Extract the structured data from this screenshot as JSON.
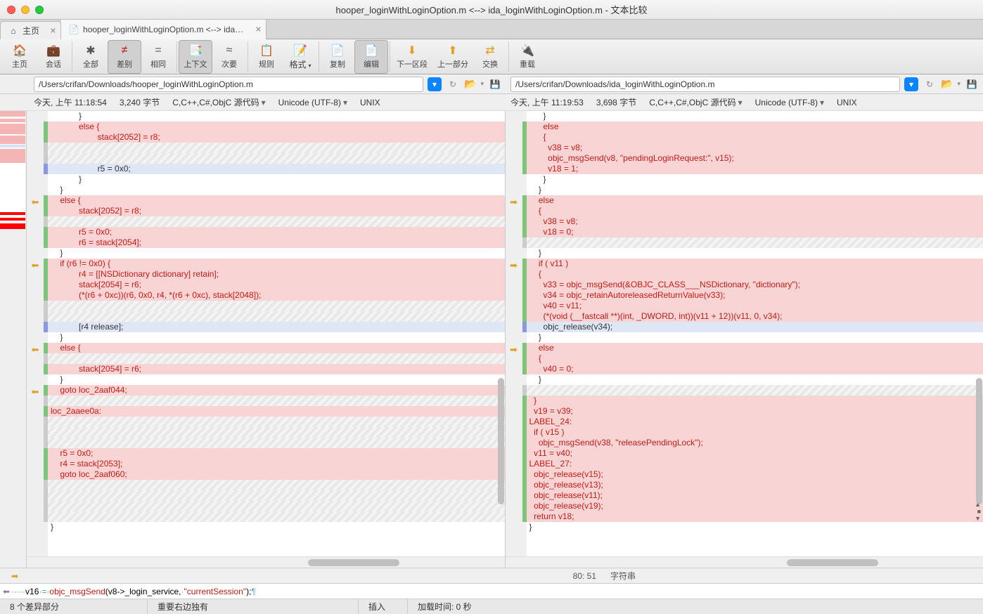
{
  "window": {
    "title": "hooper_loginWithLoginOption.m <--> ida_loginWithLoginOption.m - 文本比较"
  },
  "tabs": {
    "home": "主页",
    "compare": "hooper_loginWithLoginOption.m <--> ida_login..."
  },
  "toolbar": {
    "home": "主页",
    "session": "会话",
    "all": "全部",
    "diff": "差别",
    "same": "相同",
    "context": "上下文",
    "secondary": "次要",
    "rules": "规则",
    "format": "格式",
    "copy": "复制",
    "edit": "编辑",
    "nextsec": "下一区段",
    "prevsec": "上一部分",
    "swap": "交换",
    "reload": "重载"
  },
  "paths": {
    "left": "/Users/crifan/Downloads/hooper_loginWithLoginOption.m",
    "right": "/Users/crifan/Downloads/ida_loginWithLoginOption.m"
  },
  "meta": {
    "left": {
      "time": "今天, 上午 11:18:54",
      "size": "3,240 字节",
      "lang": "C,C++,C#,ObjC 源代码",
      "enc": "Unicode (UTF-8)",
      "eol": "UNIX"
    },
    "right": {
      "time": "今天, 上午 11:19:53",
      "size": "3,698 字节",
      "lang": "C,C++,C#,ObjC 源代码",
      "enc": "Unicode (UTF-8)",
      "eol": "UNIX"
    }
  },
  "lcode": [
    {
      "c": "",
      "t": "            }"
    },
    {
      "c": "d",
      "t": "            else {"
    },
    {
      "c": "d",
      "t": "                    stack[2052] = r8;"
    },
    {
      "c": "h",
      "t": ""
    },
    {
      "c": "h",
      "t": ""
    },
    {
      "c": "s",
      "t": "                    r5 = 0x0;"
    },
    {
      "c": "",
      "t": "            }"
    },
    {
      "c": "",
      "t": "    }"
    },
    {
      "c": "d",
      "t": "    else {"
    },
    {
      "c": "d",
      "t": "            stack[2052] = r8;"
    },
    {
      "c": "h",
      "t": ""
    },
    {
      "c": "d",
      "t": "            r5 = 0x0;"
    },
    {
      "c": "d",
      "t": "            r6 = stack[2054];"
    },
    {
      "c": "",
      "t": "    }"
    },
    {
      "c": "d",
      "t": "    if (r6 != 0x0) {"
    },
    {
      "c": "d",
      "t": "            r4 = [[NSDictionary dictionary] retain];"
    },
    {
      "c": "d",
      "t": "            stack[2054] = r6;"
    },
    {
      "c": "d",
      "t": "            (*(r6 + 0xc))(r6, 0x0, r4, *(r6 + 0xc), stack[2048]);"
    },
    {
      "c": "h",
      "t": ""
    },
    {
      "c": "h",
      "t": ""
    },
    {
      "c": "s",
      "t": "            [r4 release];"
    },
    {
      "c": "",
      "t": "    }"
    },
    {
      "c": "d",
      "t": "    else {"
    },
    {
      "c": "h",
      "t": ""
    },
    {
      "c": "d",
      "t": "            stack[2054] = r6;"
    },
    {
      "c": "",
      "t": "    }"
    },
    {
      "c": "d",
      "t": "    goto loc_2aaf044;"
    },
    {
      "c": "h",
      "t": ""
    },
    {
      "c": "d",
      "t": "loc_2aaee0a:"
    },
    {
      "c": "h",
      "t": ""
    },
    {
      "c": "h",
      "t": ""
    },
    {
      "c": "h",
      "t": ""
    },
    {
      "c": "d",
      "t": "    r5 = 0x0;"
    },
    {
      "c": "d",
      "t": "    r4 = stack[2053];"
    },
    {
      "c": "d",
      "t": "    goto loc_2aaf060;"
    },
    {
      "c": "h",
      "t": ""
    },
    {
      "c": "h",
      "t": ""
    },
    {
      "c": "h",
      "t": ""
    },
    {
      "c": "h",
      "t": ""
    },
    {
      "c": "",
      "t": "}"
    }
  ],
  "rcode": [
    {
      "c": "",
      "t": "      }"
    },
    {
      "c": "d",
      "t": "      else"
    },
    {
      "c": "d",
      "t": "      {"
    },
    {
      "c": "d",
      "t": "        v38 = v8;"
    },
    {
      "c": "d",
      "t": "        objc_msgSend(v8, \"pendingLoginRequest:\", v15);"
    },
    {
      "c": "d",
      "t": "        v18 = 1;"
    },
    {
      "c": "",
      "t": "      }"
    },
    {
      "c": "",
      "t": "    }"
    },
    {
      "c": "d",
      "t": "    else"
    },
    {
      "c": "d",
      "t": "    {"
    },
    {
      "c": "d",
      "t": "      v38 = v8;"
    },
    {
      "c": "d",
      "t": "      v18 = 0;"
    },
    {
      "c": "h",
      "t": ""
    },
    {
      "c": "",
      "t": "    }"
    },
    {
      "c": "d",
      "t": "    if ( v11 )"
    },
    {
      "c": "d",
      "t": "    {"
    },
    {
      "c": "d",
      "t": "      v33 = objc_msgSend(&OBJC_CLASS___NSDictionary, \"dictionary\");"
    },
    {
      "c": "d",
      "t": "      v34 = objc_retainAutoreleasedReturnValue(v33);"
    },
    {
      "c": "d",
      "t": "      v40 = v11;"
    },
    {
      "c": "d",
      "t": "      (*(void (__fastcall **)(int, _DWORD, int))(v11 + 12))(v11, 0, v34);"
    },
    {
      "c": "s",
      "t": "      objc_release(v34);"
    },
    {
      "c": "",
      "t": "    }"
    },
    {
      "c": "d",
      "t": "    else"
    },
    {
      "c": "d",
      "t": "    {"
    },
    {
      "c": "d",
      "t": "      v40 = 0;"
    },
    {
      "c": "",
      "t": "    }"
    },
    {
      "c": "h",
      "t": ""
    },
    {
      "c": "d",
      "t": "  }"
    },
    {
      "c": "d",
      "t": "  v19 = v39;"
    },
    {
      "c": "d",
      "t": "LABEL_24:"
    },
    {
      "c": "d",
      "t": "  if ( v15 )"
    },
    {
      "c": "d",
      "t": "    objc_msgSend(v38, \"releasePendingLock\");"
    },
    {
      "c": "d",
      "t": "  v11 = v40;"
    },
    {
      "c": "d",
      "t": "LABEL_27:"
    },
    {
      "c": "d",
      "t": "  objc_release(v15);"
    },
    {
      "c": "d",
      "t": "  objc_release(v13);"
    },
    {
      "c": "d",
      "t": "  objc_release(v11);"
    },
    {
      "c": "d",
      "t": "  objc_release(v19);"
    },
    {
      "c": "d",
      "t": "  return v18;"
    },
    {
      "c": "",
      "t": "}"
    }
  ],
  "larrows": [
    8,
    14,
    22,
    26
  ],
  "rarrows": [
    8,
    14,
    22
  ],
  "footer": {
    "pos": "80: 51",
    "type": "字符串"
  },
  "bottom": {
    "dots": "·····",
    "v": "v16",
    "eq": "·=·",
    "fn": "objc_msgSend",
    "open": "(v8->_login_service,",
    "sep": "·",
    "str": "\"currentSession\"",
    "close": ");",
    "pil": "¶"
  },
  "status": {
    "diff": "8 个差异部分",
    "context": "重要右边独有",
    "mode": "插入",
    "load": "加载时间:   0 秒"
  }
}
